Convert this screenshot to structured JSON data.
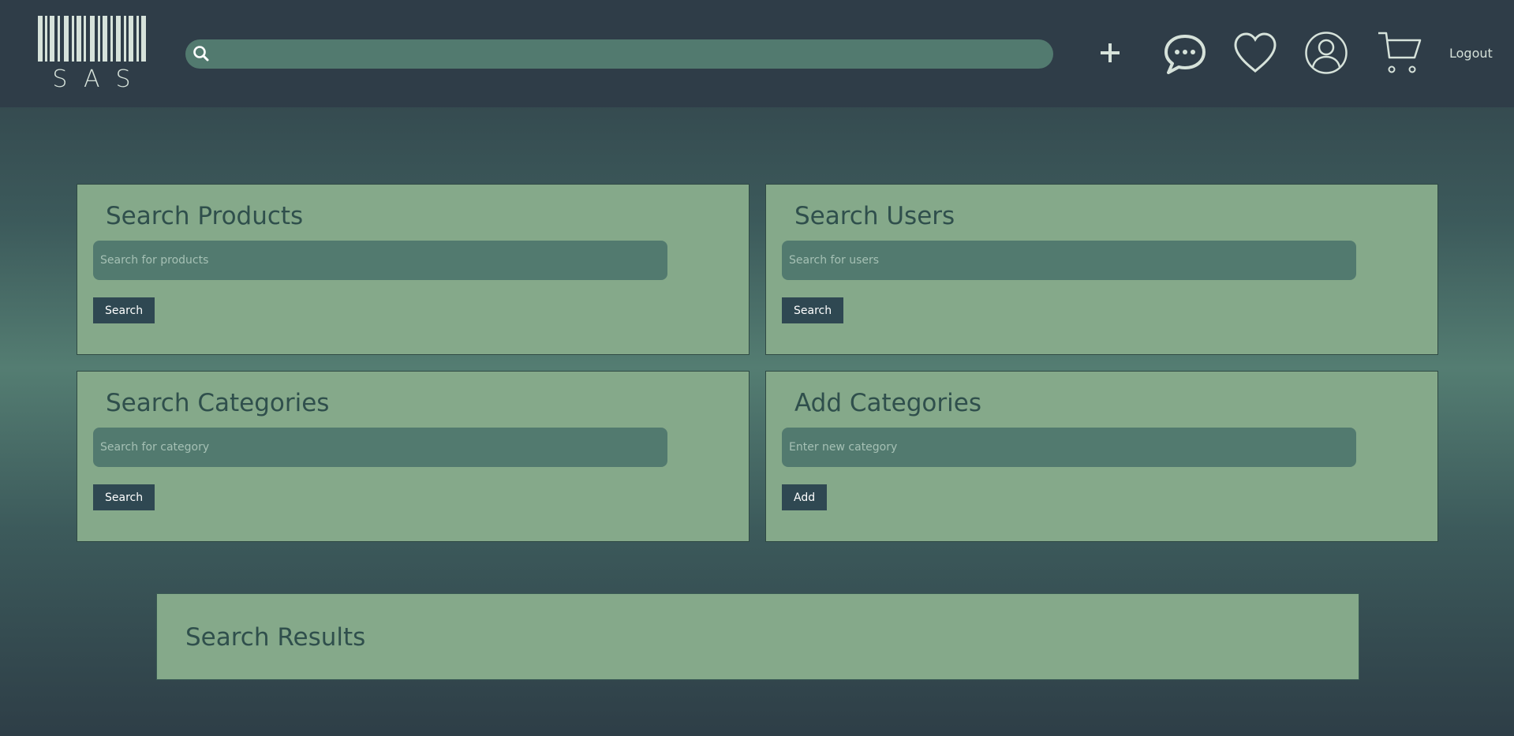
{
  "header": {
    "logo_text": "SAS",
    "search_value": "",
    "icons": [
      "plus-icon",
      "chat-icon",
      "heart-icon",
      "user-icon",
      "cart-icon"
    ],
    "logout_label": "Logout"
  },
  "panels": {
    "products": {
      "title": "Search Products",
      "placeholder": "Search for products",
      "button": "Search"
    },
    "users": {
      "title": "Search Users",
      "placeholder": "Search for users",
      "button": "Search"
    },
    "categories": {
      "title": "Search Categories",
      "placeholder": "Search for category",
      "button": "Search"
    },
    "add_categories": {
      "title": "Add Categories",
      "placeholder": "Enter new category",
      "button": "Add"
    }
  },
  "results": {
    "title": "Search Results"
  },
  "colors": {
    "header_bg": "#2f3d48",
    "card_bg": "#85a98a",
    "input_bg": "#527a6f",
    "button_bg": "#2f4852",
    "heading": "#2f4f4c",
    "icon": "#d6e2da"
  }
}
